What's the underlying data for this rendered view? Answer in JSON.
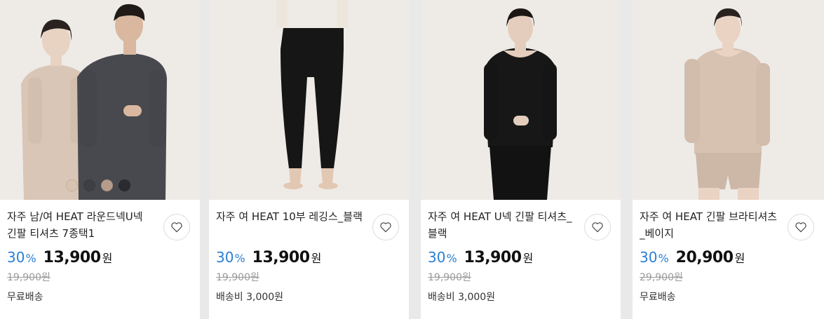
{
  "products": [
    {
      "title": "자주 남/여 HEAT 라운드넥U넥 긴팔 티셔츠 7종택1",
      "discount": "30",
      "discount_unit": "%",
      "price": "13,900",
      "currency": "원",
      "original_price": "19,900원",
      "shipping": "무료배송",
      "swatches": [
        "#d8c2b0",
        "#3d3f44",
        "#b79c8c",
        "#2a2b2e"
      ]
    },
    {
      "title": "자주 여 HEAT 10부 레깅스_블랙",
      "discount": "30",
      "discount_unit": "%",
      "price": "13,900",
      "currency": "원",
      "original_price": "19,900원",
      "shipping": "배송비 3,000원"
    },
    {
      "title": "자주 여 HEAT U넥 긴팔 티셔츠_블랙",
      "discount": "30",
      "discount_unit": "%",
      "price": "13,900",
      "currency": "원",
      "original_price": "19,900원",
      "shipping": "배송비 3,000원"
    },
    {
      "title": "자주 여 HEAT 긴팔 브라티셔츠_베이지",
      "discount": "30",
      "discount_unit": "%",
      "price": "20,900",
      "currency": "원",
      "original_price": "29,900원",
      "shipping": "무료배송"
    }
  ],
  "colors": {
    "discount": "#2a7fd5",
    "background": "#e9e9e9",
    "photo_background": "#eeebe7"
  },
  "icons": {
    "wishlist": "heart-outline-icon"
  }
}
